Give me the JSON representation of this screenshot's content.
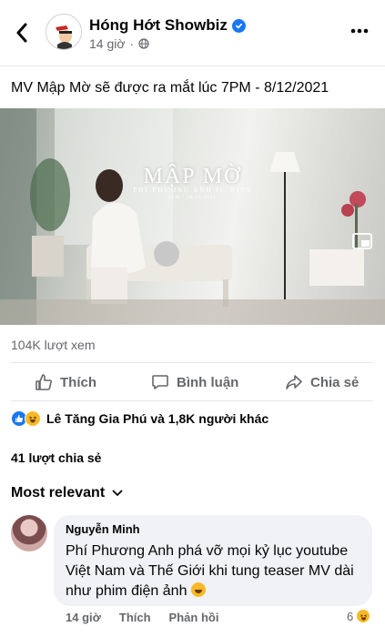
{
  "header": {
    "page_name": "Hóng Hớt Showbiz",
    "time": "14 giờ",
    "privacy_icon": "globe-icon",
    "back_icon": "chevron-left-icon",
    "more_icon": "more-dots-icon"
  },
  "post": {
    "caption": "MV Mập Mờ sẽ được ra mắt lúc 7PM - 8/12/2021",
    "video": {
      "title": "MẬP MỜ",
      "subtitle": "PHÍ PHƯƠNG ANH ft. RIN9",
      "date": "7PM · 08.12.2021",
      "watermark": "DREAMS"
    },
    "views": "104K lượt xem",
    "actions": {
      "like": "Thích",
      "comment": "Bình luận",
      "share": "Chia sẻ"
    },
    "reactions_text": "Lê Tăng Gia Phú và 1,8K người khác",
    "shares": "41 lượt chia sẻ"
  },
  "comments": {
    "sort_label": "Most relevant",
    "items": [
      {
        "author": "Nguyễn Minh",
        "text": "Phí Phương Anh phá vỡ mọi kỷ lục youtube Việt Nam và Thế Giới khi tung teaser MV dài như phim điện ảnh",
        "time": "14 giờ",
        "like_label": "Thích",
        "reply_label": "Phản hồi",
        "reaction_count": "6"
      }
    ]
  },
  "colors": {
    "brand_blue": "#1877f2",
    "muted_text": "#65676b",
    "bubble_bg": "#f0f2f5"
  }
}
